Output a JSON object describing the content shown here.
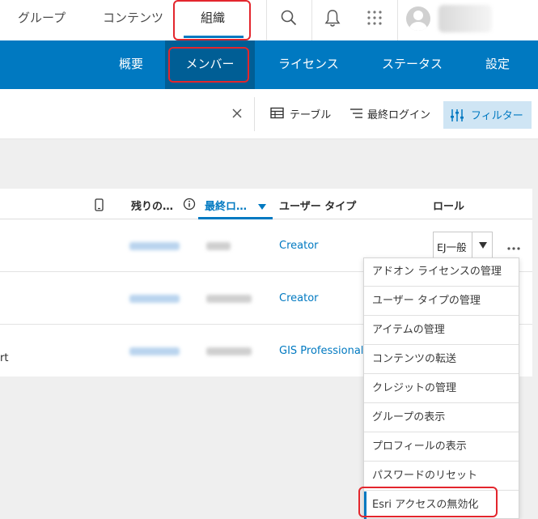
{
  "top_nav": {
    "items": [
      "グループ",
      "コンテンツ",
      "組織"
    ],
    "active_item": "組織"
  },
  "sub_nav": {
    "items": [
      "概要",
      "メンバー",
      "ライセンス",
      "ステータス",
      "設定"
    ],
    "active_item": "メンバー"
  },
  "toolbar": {
    "table_label": "テーブル",
    "last_login_label": "最終ログイン",
    "filter_label": "フィルター"
  },
  "table": {
    "headers": {
      "remaining": "残りの…",
      "last_login": "最終ロ…",
      "user_type": "ユーザー タイプ",
      "role": "ロール"
    },
    "rows": [
      {
        "user_type": "Creator",
        "role": "EJ一般"
      },
      {
        "user_type": "Creator"
      },
      {
        "user_type": "GIS Professional A",
        "left_fragment": "rt"
      }
    ]
  },
  "menu": {
    "items": [
      "アドオン ライセンスの管理",
      "ユーザー タイプの管理",
      "アイテムの管理",
      "コンテンツの転送",
      "クレジットの管理",
      "グループの表示",
      "プロフィールの表示",
      "パスワードのリセット",
      "Esri アクセスの無効化"
    ],
    "active_item": "Esri アクセスの無効化"
  },
  "icons": {
    "search": "search-icon",
    "bell": "bell-icon",
    "apps": "apps-grid-icon",
    "close": "close-icon",
    "table": "table-icon",
    "sort": "sort-lines-icon",
    "filter": "filter-sliders-icon",
    "mobile": "mobile-icon",
    "info": "info-icon",
    "more": "more-dots-icon",
    "caret": "caret-down-icon"
  },
  "colors": {
    "brand_blue": "#0079c1",
    "brand_blue_dark": "#005e95",
    "annotation_red": "#e3262d"
  }
}
